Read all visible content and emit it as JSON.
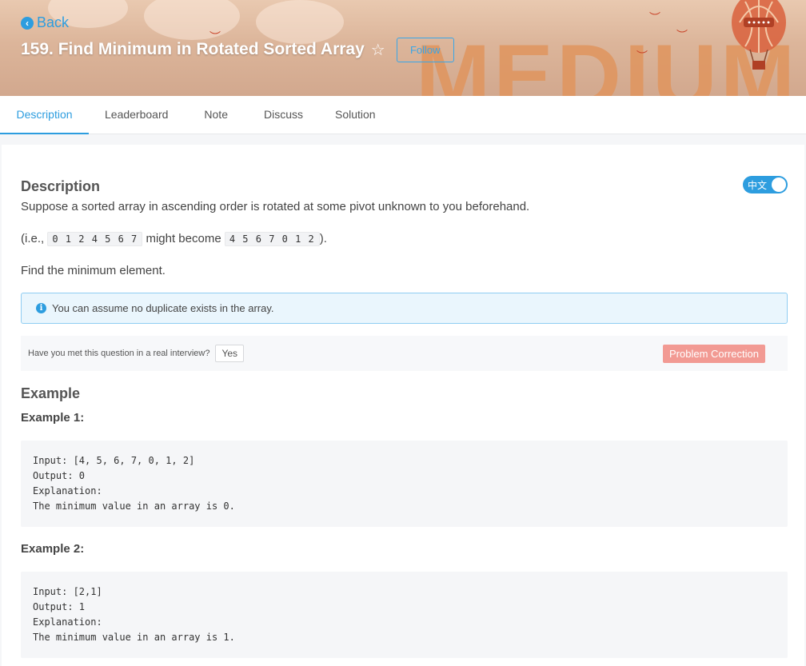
{
  "header": {
    "back_label": "Back",
    "title": "159. Find Minimum in Rotated Sorted Array",
    "follow_label": "Follow",
    "difficulty_word": "MEDIUM"
  },
  "tabs": [
    {
      "label": "Description",
      "active": true
    },
    {
      "label": "Leaderboard",
      "active": false
    },
    {
      "label": "Note",
      "active": false
    },
    {
      "label": "Discuss",
      "active": false
    },
    {
      "label": "Solution",
      "active": false
    }
  ],
  "description": {
    "heading": "Description",
    "lang_toggle": "中文",
    "line1": "Suppose a sorted array in ascending order is rotated at some pivot unknown to you beforehand.",
    "line2_prefix": "(i.e.,",
    "line2_code1": "0 1 2 4 5 6 7",
    "line2_mid": "might become",
    "line2_code2": "4 5 6 7 0 1 2",
    "line2_suffix": ").",
    "line3": "Find the minimum element.",
    "note": "You can assume no duplicate exists in the array."
  },
  "interview": {
    "question": "Have you met this question in a real interview?",
    "yes_label": "Yes",
    "correction_label": "Problem Correction"
  },
  "example": {
    "heading": "Example",
    "ex1_title": "Example 1:",
    "ex1_code": "Input: [4, 5, 6, 7, 0, 1, 2]\nOutput: 0\nExplanation:\nThe minimum value in an array is 0.",
    "ex2_title": "Example 2:",
    "ex2_code": "Input: [2,1]\nOutput: 1\nExplanation:\nThe minimum value in an array is 1."
  },
  "colors": {
    "accent": "#2d9ddf",
    "correction": "#f29a93",
    "banner": "#dcb59a"
  }
}
